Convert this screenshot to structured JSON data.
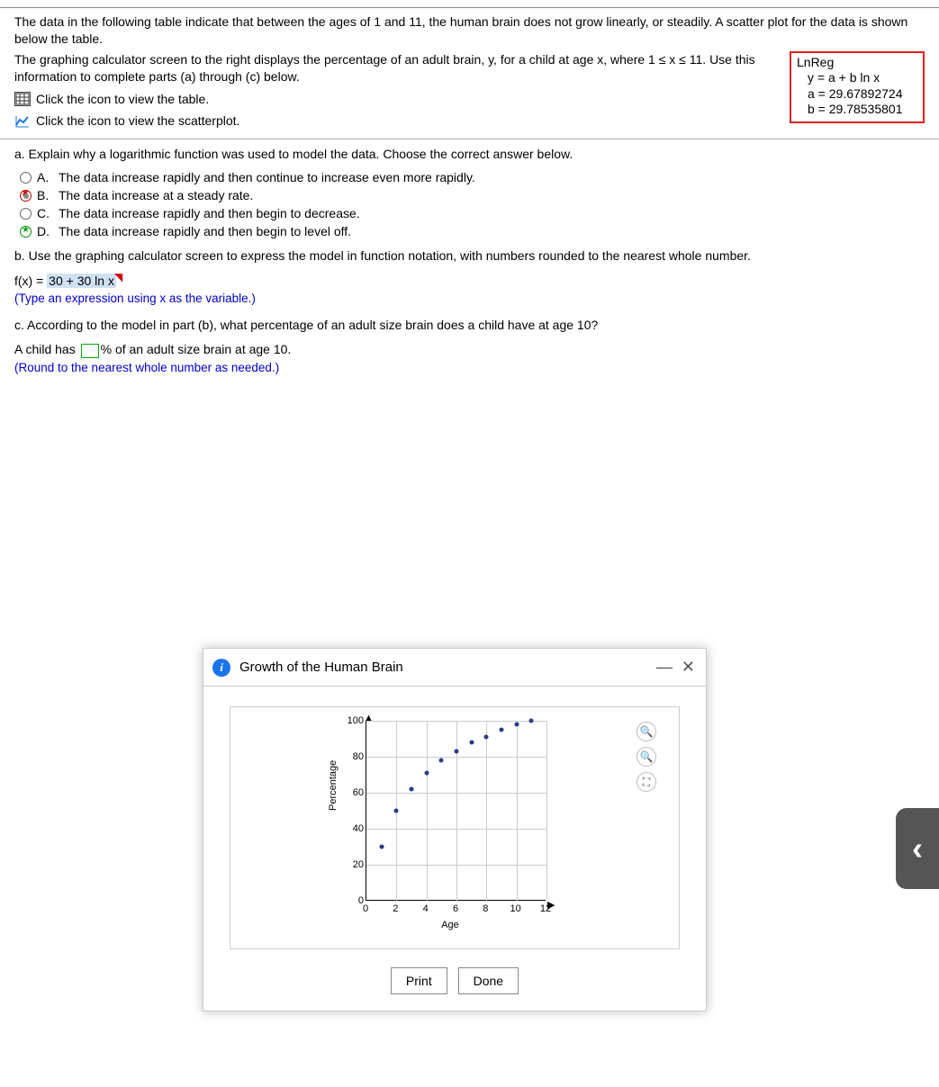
{
  "intro": "The data in the following table indicate that between the ages of 1 and 11, the human brain does not grow linearly, or steadily. A scatter plot for the data is shown below the table.",
  "intro2": "The graphing calculator screen to the right displays the percentage of an adult brain, y, for a child at age x, where 1 ≤ x ≤ 11. Use this information to complete parts (a) through (c) below.",
  "lnreg": {
    "title": "LnReg",
    "eq": "y = a + b ln x",
    "a": "a = 29.67892724",
    "b": "b = 29.78535801"
  },
  "link_table": "Click the icon to view the table.",
  "link_scatter": "Click the icon to view the scatterplot.",
  "partA": {
    "prompt": "a. Explain why a logarithmic function was used to model the data. Choose the correct answer below.",
    "choices": {
      "A": "The data increase rapidly and then continue to increase even more rapidly.",
      "B": "The data increase at a steady rate.",
      "C": "The data increase rapidly and then begin to decrease.",
      "D": "The data increase rapidly and then begin to level off."
    }
  },
  "partB": {
    "prompt": "b. Use the graphing calculator screen to express the model in function notation, with numbers rounded to the nearest whole number.",
    "fx_label": "f(x) = ",
    "fx_answer": "30 + 30 ln  x",
    "hint": "(Type an expression using x as the variable.)"
  },
  "partC": {
    "prompt": "c. According to the model in part (b), what percentage of an adult size brain does a child have at age 10?",
    "line_pre": "A child has ",
    "line_post": "% of an adult size brain at age 10.",
    "hint": "(Round to the nearest whole number as needed.)"
  },
  "modal": {
    "title": "Growth of the Human Brain",
    "ylabel": "Percentage",
    "xlabel": "Age",
    "print": "Print",
    "done": "Done"
  },
  "side_tab": "‹",
  "chart_data": {
    "type": "scatter",
    "title": "Growth of the Human Brain",
    "xlabel": "Age",
    "ylabel": "Percentage",
    "xlim": [
      0,
      12
    ],
    "ylim": [
      0,
      100
    ],
    "x_ticks": [
      0,
      2,
      4,
      6,
      8,
      10,
      12
    ],
    "y_ticks": [
      0,
      20,
      40,
      60,
      80,
      100
    ],
    "points": [
      {
        "x": 1,
        "y": 30
      },
      {
        "x": 2,
        "y": 50
      },
      {
        "x": 3,
        "y": 62
      },
      {
        "x": 4,
        "y": 71
      },
      {
        "x": 5,
        "y": 78
      },
      {
        "x": 6,
        "y": 83
      },
      {
        "x": 7,
        "y": 88
      },
      {
        "x": 8,
        "y": 91
      },
      {
        "x": 9,
        "y": 95
      },
      {
        "x": 10,
        "y": 98
      },
      {
        "x": 11,
        "y": 100
      }
    ]
  }
}
